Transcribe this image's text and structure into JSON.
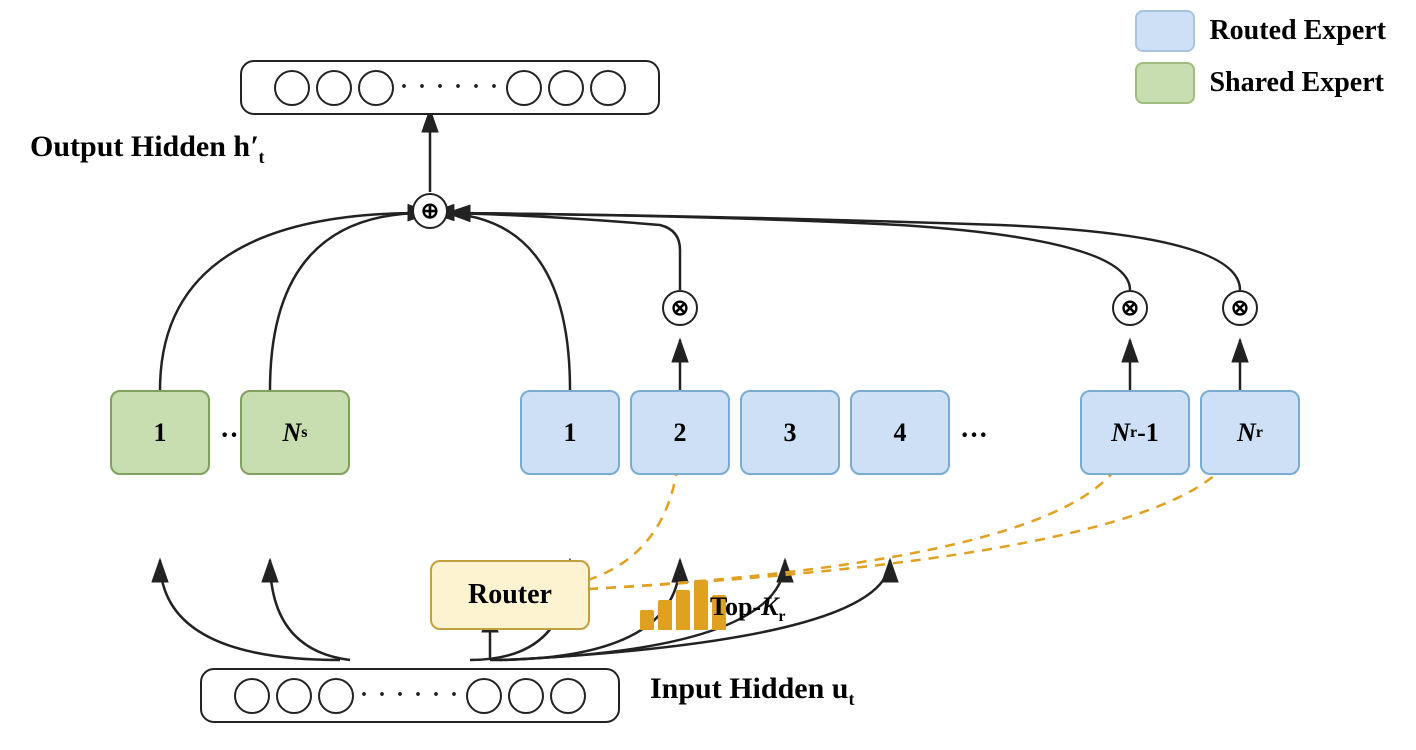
{
  "legend": {
    "routed_label": "Routed Expert",
    "shared_label": "Shared Expert"
  },
  "output_label": "Output Hidden",
  "output_math": "h′",
  "output_subscript": "t",
  "input_label": "Input Hidden",
  "input_math": "u",
  "input_subscript": "t",
  "router_label": "Router",
  "topk_label": "Top-K",
  "topk_subscript": "r",
  "shared_experts": [
    "1",
    "...",
    "N_s"
  ],
  "routed_experts": [
    "1",
    "2",
    "3",
    "4",
    "...",
    "N_r-1",
    "N_r"
  ],
  "plus_symbol": "⊕",
  "times_symbol": "⊗"
}
